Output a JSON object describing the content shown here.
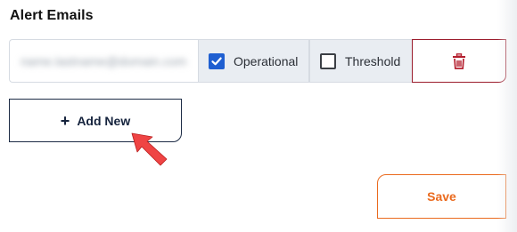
{
  "section": {
    "title": "Alert Emails"
  },
  "email_row": {
    "email_value": "name.lastname@domain.com",
    "operational": {
      "label": "Operational",
      "checked": true
    },
    "threshold": {
      "label": "Threshold",
      "checked": false
    },
    "delete_icon": "trash-icon"
  },
  "actions": {
    "add_new_label": "Add New",
    "add_new_icon": "plus-icon",
    "save_label": "Save"
  },
  "colors": {
    "checkbox_checked": "#1f5fd1",
    "delete_border": "#9b1c2c",
    "delete_icon": "#b41f2e",
    "save_accent": "#ea6a1e",
    "navy": "#15233d",
    "cell_bg": "#e9edf2",
    "arrow": "#ef4444"
  }
}
